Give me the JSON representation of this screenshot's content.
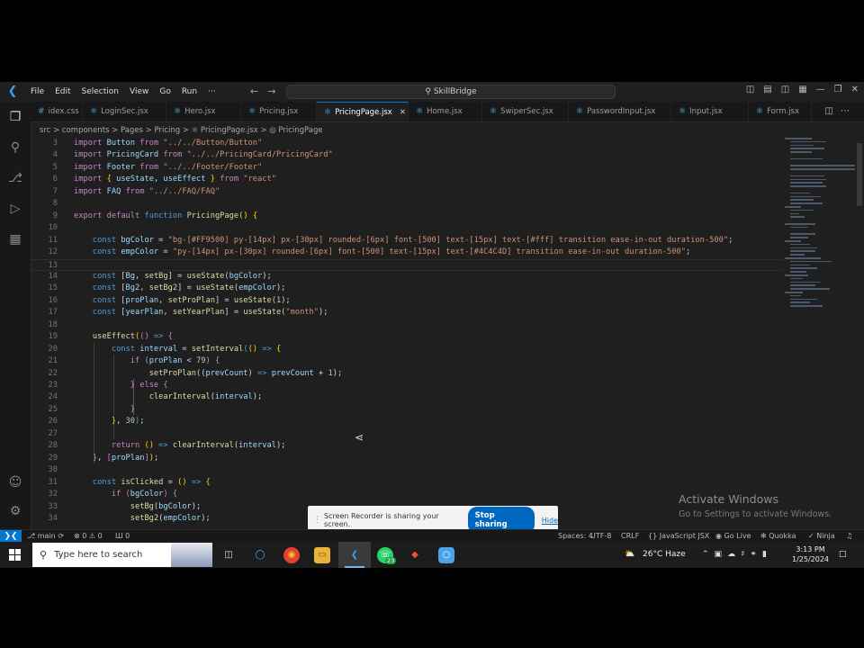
{
  "titlebar": {
    "menu": [
      "File",
      "Edit",
      "Selection",
      "View",
      "Go",
      "Run",
      "···"
    ],
    "search": "SkillBridge"
  },
  "tabs": [
    {
      "label": "idex.css",
      "icon": "#"
    },
    {
      "label": "LoginSec.jsx",
      "icon": "⚛"
    },
    {
      "label": "Hero.jsx",
      "icon": "⚛"
    },
    {
      "label": "Pricing.jsx",
      "icon": "⚛"
    },
    {
      "label": "PricingPage.jsx",
      "icon": "⚛",
      "active": true
    },
    {
      "label": "Home.jsx",
      "icon": "⚛"
    },
    {
      "label": "SwiperSec.jsx",
      "icon": "⚛"
    },
    {
      "label": "PasswordInput.jsx",
      "icon": "⚛"
    },
    {
      "label": "Input.jsx",
      "icon": "⚛"
    },
    {
      "label": "Form.jsx",
      "icon": "⚛"
    }
  ],
  "breadcrumb": "src > components > Pages > Pricing > ⚛ PricingPage.jsx > ◎ PricingPage",
  "code_lines": [
    {
      "n": "3",
      "html": "<span class='kw2'>import</span> <span class='var'>Button</span> <span class='kw2'>from</span> <span class='str'>\"../../Button/Button\"</span>"
    },
    {
      "n": "4",
      "html": "<span class='kw2'>import</span> <span class='var'>PricingCard</span> <span class='kw2'>from</span> <span class='str'>\"../../PricingCard/PricingCard\"</span>"
    },
    {
      "n": "5",
      "html": "<span class='kw2'>import</span> <span class='var'>Footer</span> <span class='kw2'>from</span> <span class='str'>\"../../Footer/Footer\"</span>"
    },
    {
      "n": "6",
      "html": "<span class='kw2'>import</span> <span class='br'>{</span> <span class='var'>useState</span>, <span class='var'>useEffect</span> <span class='br'>}</span> <span class='kw2'>from</span> <span class='str'>\"react\"</span>"
    },
    {
      "n": "7",
      "html": "<span class='kw2'>import</span> <span class='var'>FAQ</span> <span class='kw2'>from</span> <span class='str'>\"../../FAQ/FAQ\"</span>"
    },
    {
      "n": "8",
      "html": ""
    },
    {
      "n": "9",
      "html": "<span class='kw2'>export</span> <span class='kw2'>default</span> <span class='kw'>function</span> <span class='fn'>PricingPage</span><span class='br'>()</span> <span class='br'>{</span>"
    },
    {
      "n": "10",
      "html": ""
    },
    {
      "n": "11",
      "html": "    <span class='kw'>const</span> <span class='var'>bgColor</span> = <span class='str'>\"bg-[#FF9500] py-[14px] px-[30px] rounded-[6px] font-[500] text-[15px] text-[#fff] transition ease-in-out duration-500\"</span>;"
    },
    {
      "n": "12",
      "html": "    <span class='kw'>const</span> <span class='var'>empColor</span> = <span class='str'>\"py-[14px] px-[30px] rounded-[6px] font-[500] text-[15px] text-[#4C4C4D] transition ease-in-out duration-500\"</span>;"
    },
    {
      "n": "13",
      "html": "",
      "current": true
    },
    {
      "n": "14",
      "html": "    <span class='kw'>const</span> [<span class='var'>Bg</span>, <span class='fn'>setBg</span>] = <span class='fn'>useState</span>(<span class='var'>bgColor</span>);"
    },
    {
      "n": "15",
      "html": "    <span class='kw'>const</span> [<span class='var'>Bg2</span>, <span class='fn'>setBg2</span>] = <span class='fn'>useState</span>(<span class='var'>empColor</span>);"
    },
    {
      "n": "16",
      "html": "    <span class='kw'>const</span> [<span class='var'>proPlan</span>, <span class='fn'>setProPlan</span>] = <span class='fn'>useState</span>(<span class='num'>1</span>);"
    },
    {
      "n": "17",
      "html": "    <span class='kw'>const</span> [<span class='var'>yearPlan</span>, <span class='fn'>setYearPlan</span>] = <span class='fn'>useState</span>(<span class='str'>\"month\"</span>);"
    },
    {
      "n": "18",
      "html": ""
    },
    {
      "n": "19",
      "html": "    <span class='fn'>useEffect</span><span class='br'>(</span><span class='kw2'>()</span> <span class='kw'>=&gt;</span> <span class='kw2'>{</span>"
    },
    {
      "n": "20",
      "html": "        <span class='kw'>const</span> <span class='var'>interval</span> = <span class='fn'>setInterval</span><span class='kw'>(</span><span class='br'>()</span> <span class='kw'>=&gt;</span> <span class='br'>{</span>"
    },
    {
      "n": "21",
      "html": "            <span class='kw2'>if</span> <span class='kw2'>(</span><span class='var'>proPlan</span> &lt; <span class='num'>79</span><span class='kw2'>)</span> <span class='kw2'>{</span>"
    },
    {
      "n": "22",
      "html": "                <span class='fn'>setProPlan</span>((<span class='var'>prevCount</span>) <span class='kw'>=&gt;</span> <span class='var'>prevCount</span> + <span class='num'>1</span>);"
    },
    {
      "n": "23",
      "html": "            <span class='kw2'>}</span> <span class='kw2'>else</span> <span class='kw2'>{</span>"
    },
    {
      "n": "24",
      "html": "                <span class='fn'>clearInterval</span>(<span class='var'>interval</span>);"
    },
    {
      "n": "25",
      "html": "            <span class='kw2'>}</span>"
    },
    {
      "n": "26",
      "html": "        <span class='br'>}</span>, <span class='num'>30</span><span class='kw'>)</span>;"
    },
    {
      "n": "27",
      "html": ""
    },
    {
      "n": "28",
      "html": "        <span class='kw2'>return</span> <span class='br'>()</span> <span class='kw'>=&gt;</span> <span class='fn'>clearInterval</span>(<span class='var'>interval</span>);"
    },
    {
      "n": "29",
      "html": "    <span class='kw2'>}</span>, <span class='kw2'>[</span><span class='var'>proPlan</span><span class='kw2'>]</span><span class='br'>)</span>;"
    },
    {
      "n": "30",
      "html": ""
    },
    {
      "n": "31",
      "html": "    <span class='kw'>const</span> <span class='fn'>isClicked</span> = <span class='br'>()</span> <span class='kw'>=&gt;</span> <span class='br'>{</span>"
    },
    {
      "n": "32",
      "html": "        <span class='kw2'>if</span> <span class='kw2'>(</span><span class='var'>bgColor</span><span class='kw2'>)</span> <span class='kw2'>{</span>"
    },
    {
      "n": "33",
      "html": "            <span class='fn'>setBg</span>(<span class='var'>bgColor</span>);"
    },
    {
      "n": "34",
      "html": "            <span class='fn'>setBg2</span>(<span class='var'>empColor</span>);"
    }
  ],
  "watermark": {
    "title": "Activate Windows",
    "subtitle": "Go to Settings to activate Windows."
  },
  "recorder": {
    "message": "Screen Recorder is sharing your screen.",
    "stop_label": "Stop sharing",
    "hide_label": "Hide"
  },
  "statusbar": {
    "branch": "main",
    "problems": "⊗ 0 ⚠ 0",
    "ports": "Ш 0",
    "spaces": "Spaces: 4",
    "encoding": "UTF-8",
    "eol": "CRLF",
    "language": "{} JavaScript JSX",
    "golive": "Go Live",
    "quokka": "Quokka",
    "ninja": "Ninja"
  },
  "taskbar": {
    "search_placeholder": "Type here to search",
    "weather": "26°C Haze",
    "whatsapp_badge": "23",
    "time": "3:13 PM",
    "date": "1/25/2024"
  }
}
